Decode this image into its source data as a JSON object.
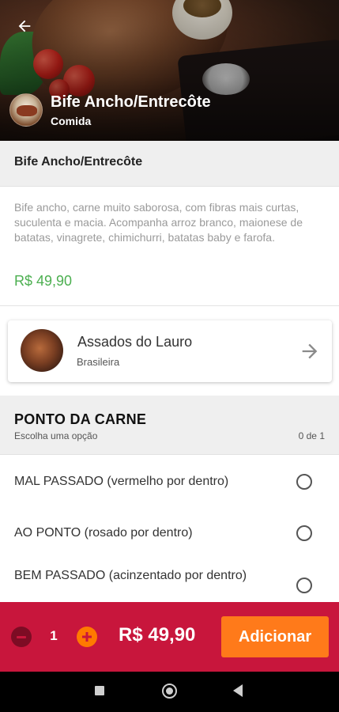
{
  "header": {
    "title": "Bife Ancho/Entrecôte",
    "subtitle": "Comida",
    "back_icon": "arrow-left-icon"
  },
  "product": {
    "name": "Bife Ancho/Entrecôte",
    "description": "Bife ancho, carne muito saborosa, com fibras mais curtas, suculenta e macia. Acompanha arroz branco, maionese de batatas, vinagrete, chimichurri, batatas baby e farofa.",
    "price": "R$ 49,90"
  },
  "store": {
    "name": "Assados do Lauro",
    "category": "Brasileira",
    "arrow_icon": "arrow-right-icon"
  },
  "options_group": {
    "title": "PONTO DA CARNE",
    "subtitle": "Escolha uma opção",
    "count": "0 de 1",
    "options": [
      {
        "label": "MAL PASSADO (vermelho por dentro)",
        "selected": false
      },
      {
        "label": "AO PONTO (rosado por dentro)",
        "selected": false
      },
      {
        "label": "BEM PASSADO (acinzentado por dentro)",
        "selected": false
      }
    ]
  },
  "order": {
    "quantity": "1",
    "total": "R$ 49,90",
    "add_label": "Adicionar"
  },
  "colors": {
    "accent_red": "#c8163c",
    "accent_orange": "#ff7a1a",
    "price_green": "#4caf50"
  }
}
